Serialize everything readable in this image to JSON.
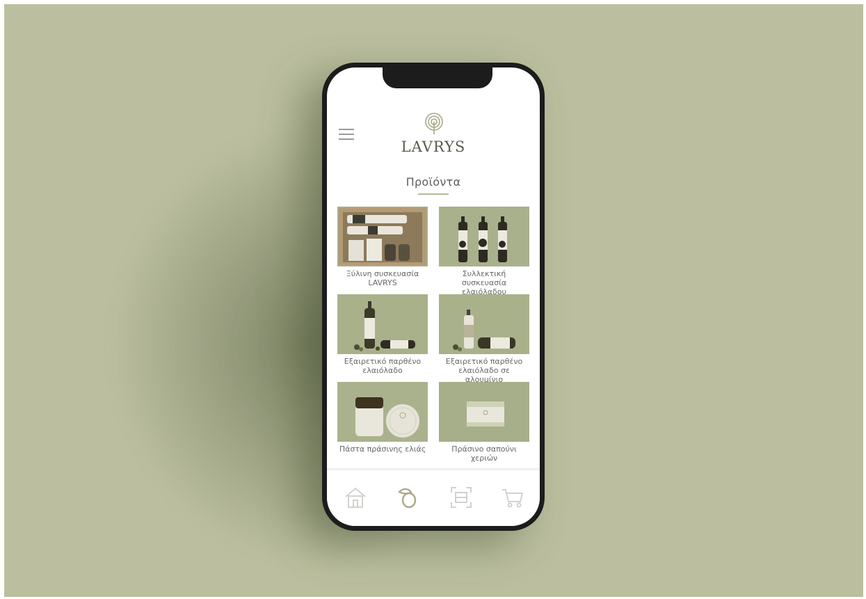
{
  "app": {
    "brand": "LAVRYS",
    "section_title": "Προϊόντα"
  },
  "products": [
    {
      "label": "Ξύλινη συσκευασία LAVRYS"
    },
    {
      "label": "Συλλεκτική συσκευασία ελαιόλαδου"
    },
    {
      "label": "Εξαιρετικό παρθένο ελαιόλαδο"
    },
    {
      "label": "Εξαιρετικό παρθένο ελαιόλαδο σε αλουμίνιο"
    },
    {
      "label": "Πάστα πράσινης ελιάς"
    },
    {
      "label": "Πράσινο σαπούνι χεριών"
    }
  ],
  "nav": {
    "items": [
      {
        "icon": "home-icon"
      },
      {
        "icon": "olive-icon",
        "active": true
      },
      {
        "icon": "scan-icon"
      },
      {
        "icon": "cart-icon"
      }
    ]
  },
  "colors": {
    "background": "#bbbf9f",
    "accent": "#b9b995",
    "product_bg": "#a8b08a"
  }
}
